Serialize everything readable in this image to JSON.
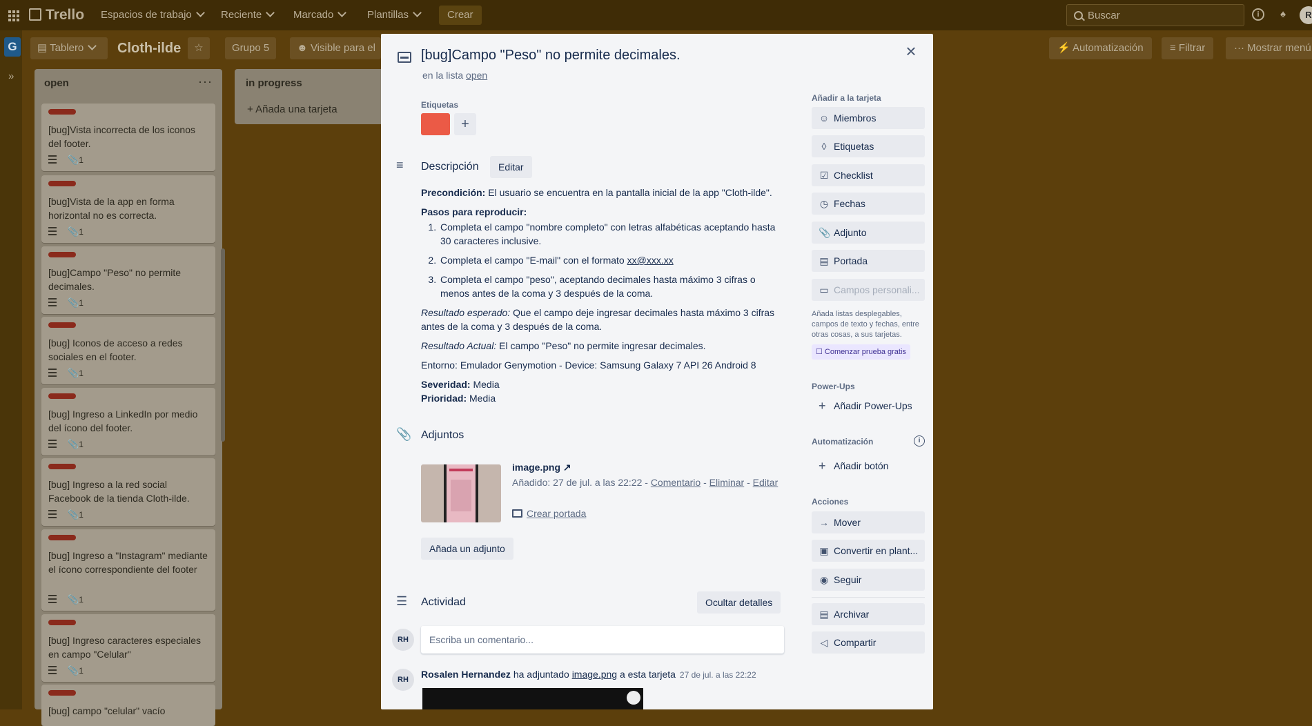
{
  "topbar": {
    "logo": "Trello",
    "nav": [
      "Espacios de trabajo",
      "Reciente",
      "Marcado",
      "Plantillas"
    ],
    "create": "Crear",
    "search_placeholder": "Buscar",
    "avatar": "R"
  },
  "workspace": {
    "badge": "G",
    "expand": "»"
  },
  "board_bar": {
    "view": "Tablero",
    "title": "Cloth-ilde",
    "group": "Grupo 5",
    "visibility": "Visible para el",
    "automation": "Automatización",
    "filter": "Filtrar",
    "menu": "Mostrar menú"
  },
  "lists": [
    {
      "title": "open",
      "more": "···",
      "cards": [
        {
          "text": "[bug]Vista incorrecta de los iconos del footer.",
          "attachments": "1"
        },
        {
          "text": "[bug]Vista de la app en forma horizontal no es correcta.",
          "attachments": "1"
        },
        {
          "text": "[bug]Campo \"Peso\" no permite decimales.",
          "attachments": "1"
        },
        {
          "text": "[bug] Iconos de acceso a redes sociales en el footer.",
          "attachments": "1"
        },
        {
          "text": "[bug] Ingreso a LinkedIn por medio del ícono del footer.",
          "attachments": "1"
        },
        {
          "text": "[bug] Ingreso a la red social Facebook de la tienda Cloth-ilde.",
          "attachments": "1"
        },
        {
          "text": "[bug] Ingreso a \"Instagram\" mediante el ícono correspondiente del footer",
          "attachments": "1"
        },
        {
          "text": "[bug] Ingreso caracteres especiales en campo \"Celular\"",
          "attachments": "1"
        },
        {
          "text": "[bug] campo \"celular\" vacío",
          "attachments": ""
        }
      ]
    },
    {
      "title": "in progress",
      "add_card": "Añada una tarjeta"
    }
  ],
  "modal": {
    "title": "[bug]Campo \"Peso\" no permite decimales.",
    "in_list_prefix": "en la lista",
    "in_list_name": "open",
    "labels_heading": "Etiquetas",
    "label_color": "#eb5a46",
    "description_heading": "Descripción",
    "edit": "Editar",
    "description": {
      "precondition_label": "Precondición:",
      "precondition": " El usuario se encuentra en la pantalla inicial de la app \"Cloth-ilde\".",
      "steps_label": "Pasos para reproducir:",
      "step1": "Completa el campo \"nombre completo\" con letras alfabéticas aceptando hasta 30 caracteres inclusive.",
      "step2_prefix": "Completa el campo \"E-mail\" con el formato ",
      "step2_link": "xx@xxx.xx",
      "step3": "Completa el campo \"peso\", aceptando decimales hasta máximo 3 cifras o menos antes de la coma y 3 después de la coma.",
      "expected_label": "Resultado esperado:",
      "expected": " Que el campo deje ingresar decimales hasta máximo 3 cifras antes de la coma y 3 después de la coma.",
      "actual_label": "Resultado Actual:",
      "actual": " El campo \"Peso\" no permite ingresar decimales.",
      "environment": "Entorno: Emulador Genymotion - Device: Samsung Galaxy 7 API 26 Android 8",
      "severity_label": "Severidad:",
      "severity": " Media",
      "priority_label": "Prioridad:",
      "priority": " Media"
    },
    "attachments_heading": "Adjuntos",
    "attachment": {
      "name": "image.png",
      "arrow": "↗",
      "added": "Añadido: 27 de jul. a las 22:22 - ",
      "comment": "Comentario",
      "sep": " - ",
      "delete": "Eliminar",
      "sep2": " - ",
      "edit": "Editar",
      "make_cover": "Crear portada"
    },
    "add_attachment": "Añada un adjunto",
    "activity_heading": "Actividad",
    "hide_details": "Ocultar detalles",
    "avatar_initials": "RH",
    "comment_placeholder": "Escriba un comentario...",
    "activity_item": {
      "user": "Rosalen Hernandez",
      "action": " ha adjuntado ",
      "file": "image.png",
      "suffix": " a esta tarjeta",
      "time": "27 de jul. a las 22:22"
    },
    "close": "×"
  },
  "sidebar": {
    "add_heading": "Añadir a la tarjeta",
    "members": "Miembros",
    "labels": "Etiquetas",
    "checklist": "Checklist",
    "dates": "Fechas",
    "attachment": "Adjunto",
    "cover": "Portada",
    "custom_fields": "Campos personali...",
    "custom_note": "Añada listas desplegables, campos de texto y fechas, entre otras cosas, a sus tarjetas.",
    "trial": "Comenzar prueba gratis",
    "powerups_heading": "Power-Ups",
    "add_powerups": "Añadir Power-Ups",
    "automation_heading": "Automatización",
    "add_button": "Añadir botón",
    "actions_heading": "Acciones",
    "move": "Mover",
    "template": "Convertir en plant...",
    "follow": "Seguir",
    "archive": "Archivar",
    "share": "Compartir"
  }
}
